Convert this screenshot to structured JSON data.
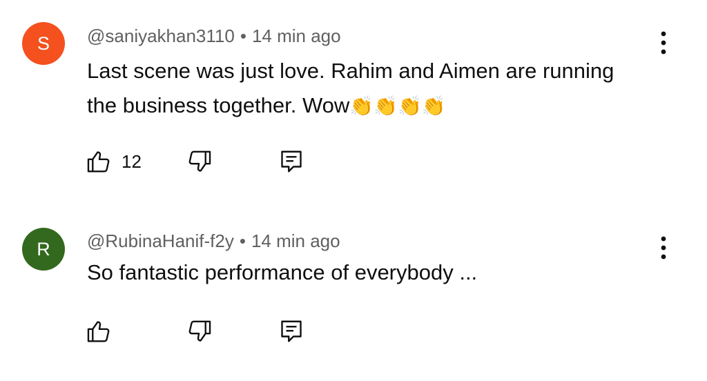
{
  "colors": {
    "avatar_s": "#f4511e",
    "avatar_r": "#33691e",
    "meta_text": "#606060",
    "body_text": "#0f0f0f"
  },
  "comments": [
    {
      "avatar_letter": "S",
      "username": "@saniyakhan3110",
      "separator": "•",
      "time": "14 min ago",
      "text": "Last scene was just love. Rahim and Aimen are running the business together. Wow",
      "emoji": "👏👏👏👏",
      "like_count": "12"
    },
    {
      "avatar_letter": "R",
      "username": "@RubinaHanif-f2y",
      "separator": "•",
      "time": "14 min ago",
      "text": "So fantastic performance of everybody ...",
      "emoji": "",
      "like_count": ""
    }
  ],
  "icons": {
    "like": "thumbs-up-icon",
    "dislike": "thumbs-down-icon",
    "reply": "reply-icon",
    "more": "more-vertical-icon"
  }
}
